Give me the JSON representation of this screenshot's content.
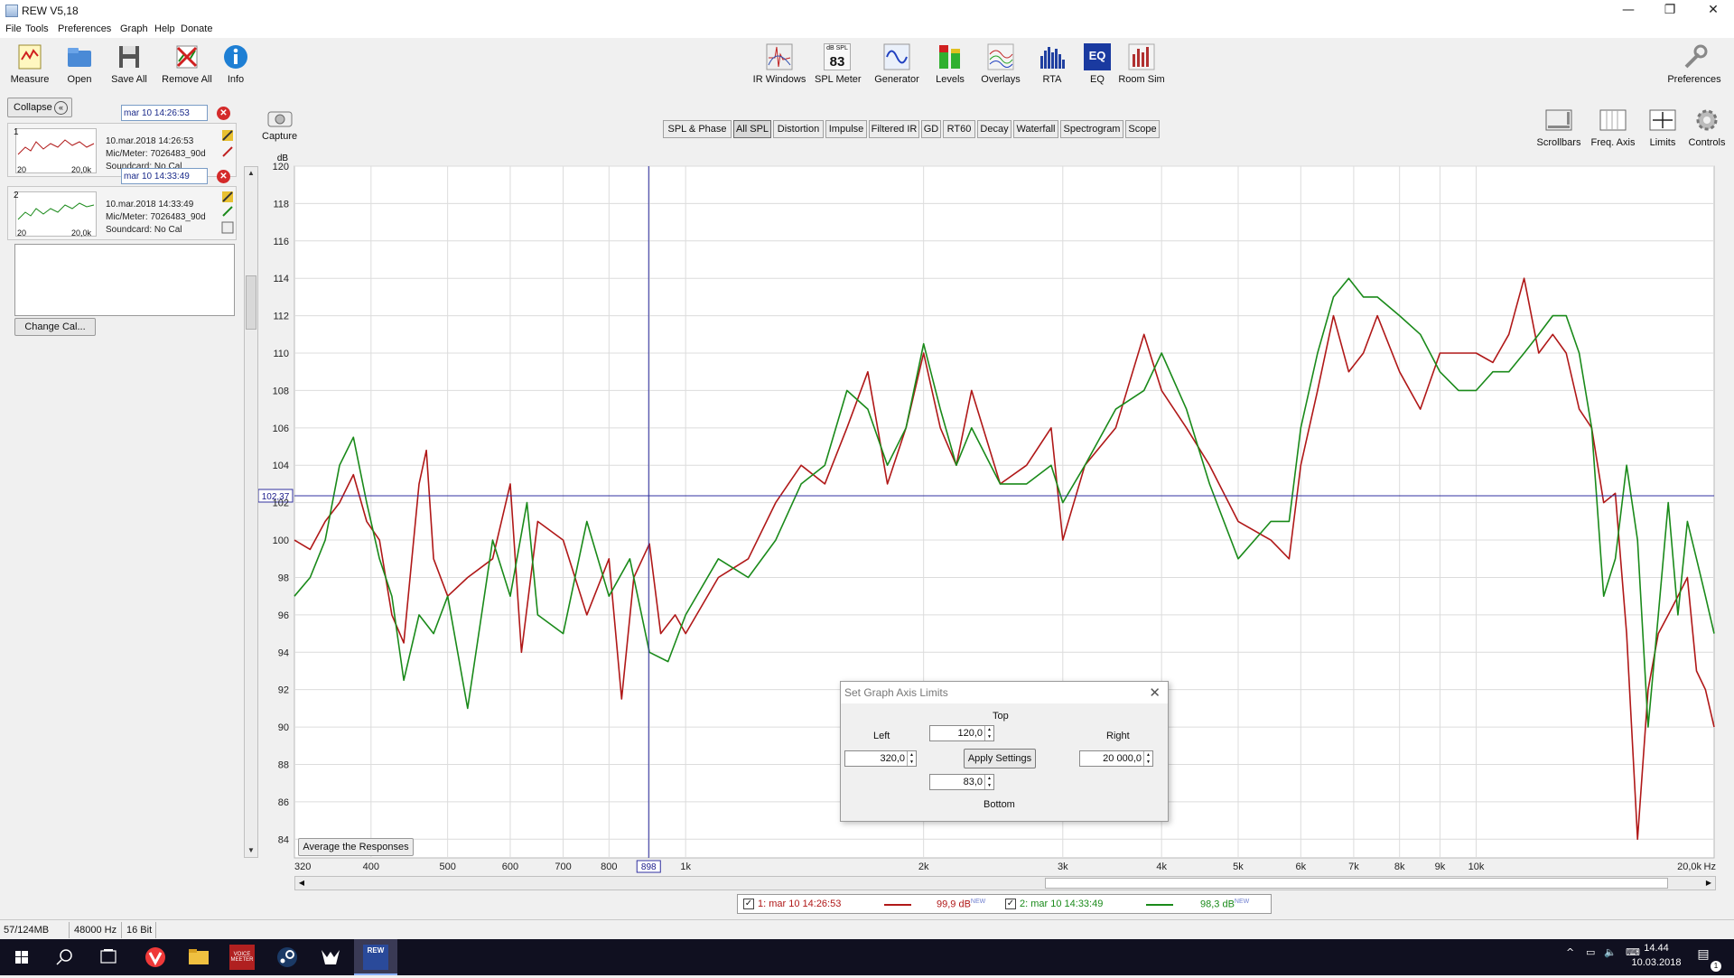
{
  "window": {
    "title": "REW V5,18",
    "minimize": "—",
    "restore": "❐",
    "close": "✕"
  },
  "menu": [
    "File",
    "Tools",
    "Preferences",
    "Graph",
    "Help",
    "Donate"
  ],
  "toolbar_left": [
    {
      "label": "Measure",
      "icon": "measure-icon"
    },
    {
      "label": "Open",
      "icon": "folder-icon"
    },
    {
      "label": "Save All",
      "icon": "save-icon"
    },
    {
      "label": "Remove All",
      "icon": "remove-icon"
    },
    {
      "label": "Info",
      "icon": "info-icon"
    }
  ],
  "toolbar_center": [
    {
      "label": "IR Windows",
      "icon": "ir-windows-icon"
    },
    {
      "label": "SPL Meter",
      "icon": "spl-meter-icon",
      "badge_top": "dB SPL",
      "badge_value": "83"
    },
    {
      "label": "Generator",
      "icon": "generator-icon"
    },
    {
      "label": "Levels",
      "icon": "levels-icon"
    },
    {
      "label": "Overlays",
      "icon": "overlays-icon"
    },
    {
      "label": "RTA",
      "icon": "rta-icon"
    },
    {
      "label": "EQ",
      "icon": "eq-icon",
      "badge_value": "EQ"
    },
    {
      "label": "Room Sim",
      "icon": "room-sim-icon"
    }
  ],
  "preferences": {
    "label": "Preferences",
    "icon": "wrench-icon"
  },
  "panel": {
    "collapse_label": "Collapse",
    "measurements": [
      {
        "num": "1",
        "name": "mar 10 14:26:53",
        "date": "10.mar.2018 14:26:53",
        "mic": "Mic/Meter: 7026483_90d",
        "soundcard": "Soundcard: No Cal",
        "thumb_left": "20",
        "thumb_right": "20,0k",
        "color": "#b01818"
      },
      {
        "num": "2",
        "name": "mar 10 14:33:49",
        "date": "10.mar.2018 14:33:49",
        "mic": "Mic/Meter: 7026483_90d",
        "soundcard": "Soundcard: No Cal",
        "thumb_left": "20",
        "thumb_right": "20,0k",
        "color": "#1a8a1a"
      }
    ],
    "change_cal": "Change Cal..."
  },
  "capture_label": "Capture",
  "tabs": [
    {
      "label": "SPL & Phase",
      "active": false
    },
    {
      "label": "All SPL",
      "active": true
    },
    {
      "label": "Distortion",
      "active": false
    },
    {
      "label": "Impulse",
      "active": false
    },
    {
      "label": "Filtered IR",
      "active": false
    },
    {
      "label": "GD",
      "active": false
    },
    {
      "label": "RT60",
      "active": false
    },
    {
      "label": "Decay",
      "active": false
    },
    {
      "label": "Waterfall",
      "active": false
    },
    {
      "label": "Spectrogram",
      "active": false
    },
    {
      "label": "Scope",
      "active": false
    }
  ],
  "right_tools": [
    {
      "label": "Scrollbars",
      "icon": "scrollbars-icon"
    },
    {
      "label": "Freq. Axis",
      "icon": "freq-axis-icon"
    },
    {
      "label": "Limits",
      "icon": "limits-icon"
    },
    {
      "label": "Controls",
      "icon": "gear-icon"
    }
  ],
  "average_button": "Average the Responses",
  "cursor": {
    "freq_label": "898",
    "level_label": "102,37",
    "freq": 898,
    "level": 102.37
  },
  "legend": [
    {
      "name": "1: mar 10 14:26:53",
      "value": "99,9 dB",
      "tag": "NEW",
      "color": "#b01818",
      "checked": "✓"
    },
    {
      "name": "2: mar 10 14:33:49",
      "value": "98,3 dB",
      "tag": "NEW",
      "color": "#1a8a1a",
      "checked": "✓"
    }
  ],
  "status": {
    "memory": "57/124MB",
    "rate": "48000 Hz",
    "bits": "16 Bit"
  },
  "dialog": {
    "title": "Set Graph Axis Limits",
    "top_label": "Top",
    "left_label": "Left",
    "right_label": "Right",
    "bottom_label": "Bottom",
    "top_value": "120,0",
    "left_value": "320,0",
    "right_value": "20 000,0",
    "bottom_value": "83,0",
    "apply_label": "Apply Settings"
  },
  "taskbar": {
    "time": "14.44",
    "date": "10.03.2018",
    "apps": [
      "start-icon",
      "search-icon",
      "task-view-icon",
      "vivaldi-icon",
      "file-explorer-icon",
      "voicemeeter-icon",
      "steam-icon",
      "app-icon",
      "rew-icon"
    ],
    "voicemeeter_text": "VOICE MEETER",
    "rew_text": "REW",
    "notification_count": "1"
  },
  "chart_data": {
    "type": "line",
    "xscale": "log",
    "xlim": [
      320,
      20000
    ],
    "ylim": [
      83,
      120
    ],
    "ylabel": "dB",
    "xunit": "Hz",
    "yticks": [
      "84",
      "86",
      "88",
      "90",
      "92",
      "94",
      "96",
      "98",
      "100",
      "102",
      "104",
      "106",
      "108",
      "110",
      "112",
      "114",
      "116",
      "118",
      "120"
    ],
    "xticks": [
      {
        "v": 320,
        "l": "320"
      },
      {
        "v": 400,
        "l": "400"
      },
      {
        "v": 500,
        "l": "500"
      },
      {
        "v": 600,
        "l": "600"
      },
      {
        "v": 700,
        "l": "700"
      },
      {
        "v": 800,
        "l": "800"
      },
      {
        "v": 1000,
        "l": "1k"
      },
      {
        "v": 2000,
        "l": "2k"
      },
      {
        "v": 3000,
        "l": "3k"
      },
      {
        "v": 4000,
        "l": "4k"
      },
      {
        "v": 5000,
        "l": "5k"
      },
      {
        "v": 6000,
        "l": "6k"
      },
      {
        "v": 7000,
        "l": "7k"
      },
      {
        "v": 8000,
        "l": "8k"
      },
      {
        "v": 9000,
        "l": "9k"
      },
      {
        "v": 10000,
        "l": "10k"
      },
      {
        "v": 20000,
        "l": "20,0k"
      }
    ],
    "xunit_label": "Hz",
    "series": [
      {
        "name": "1: mar 10 14:26:53",
        "color": "#b01818",
        "points": [
          [
            320,
            100
          ],
          [
            335,
            99.5
          ],
          [
            350,
            101
          ],
          [
            365,
            102
          ],
          [
            380,
            103.5
          ],
          [
            395,
            101
          ],
          [
            410,
            100
          ],
          [
            425,
            96
          ],
          [
            440,
            94.5
          ],
          [
            460,
            103
          ],
          [
            470,
            104.8
          ],
          [
            480,
            99
          ],
          [
            500,
            97
          ],
          [
            530,
            98
          ],
          [
            570,
            99
          ],
          [
            600,
            103
          ],
          [
            620,
            94
          ],
          [
            650,
            101
          ],
          [
            700,
            100
          ],
          [
            750,
            96
          ],
          [
            800,
            99
          ],
          [
            830,
            91.5
          ],
          [
            860,
            98
          ],
          [
            900,
            99.8
          ],
          [
            930,
            95
          ],
          [
            970,
            96
          ],
          [
            1000,
            95
          ],
          [
            1100,
            98
          ],
          [
            1200,
            99
          ],
          [
            1300,
            102
          ],
          [
            1400,
            104
          ],
          [
            1500,
            103
          ],
          [
            1600,
            106
          ],
          [
            1700,
            109
          ],
          [
            1800,
            103
          ],
          [
            1900,
            106
          ],
          [
            2000,
            110
          ],
          [
            2100,
            106
          ],
          [
            2200,
            104
          ],
          [
            2300,
            108
          ],
          [
            2500,
            103
          ],
          [
            2700,
            104
          ],
          [
            2900,
            106
          ],
          [
            3000,
            100
          ],
          [
            3200,
            104
          ],
          [
            3500,
            106
          ],
          [
            3800,
            111
          ],
          [
            4000,
            108
          ],
          [
            4300,
            106
          ],
          [
            4600,
            104
          ],
          [
            5000,
            101
          ],
          [
            5500,
            100
          ],
          [
            5800,
            99
          ],
          [
            6000,
            104
          ],
          [
            6300,
            108
          ],
          [
            6600,
            112
          ],
          [
            6900,
            109
          ],
          [
            7200,
            110
          ],
          [
            7500,
            112
          ],
          [
            8000,
            109
          ],
          [
            8500,
            107
          ],
          [
            9000,
            110
          ],
          [
            9500,
            110
          ],
          [
            10000,
            110
          ],
          [
            10500,
            109.5
          ],
          [
            11000,
            111
          ],
          [
            11500,
            114
          ],
          [
            12000,
            110
          ],
          [
            12500,
            111
          ],
          [
            13000,
            110
          ],
          [
            13500,
            107
          ],
          [
            14000,
            106
          ],
          [
            14500,
            102
          ],
          [
            15000,
            102.5
          ],
          [
            15500,
            95
          ],
          [
            16000,
            84
          ],
          [
            16500,
            92
          ],
          [
            17000,
            95
          ],
          [
            17500,
            96
          ],
          [
            18000,
            97
          ],
          [
            18500,
            98
          ],
          [
            19000,
            93
          ],
          [
            19500,
            92
          ],
          [
            20000,
            90
          ]
        ]
      },
      {
        "name": "2: mar 10 14:33:49",
        "color": "#1a8a1a",
        "points": [
          [
            320,
            97
          ],
          [
            335,
            98
          ],
          [
            350,
            100
          ],
          [
            365,
            104
          ],
          [
            380,
            105.5
          ],
          [
            395,
            102
          ],
          [
            410,
            99
          ],
          [
            425,
            97
          ],
          [
            440,
            92.5
          ],
          [
            460,
            96
          ],
          [
            480,
            95
          ],
          [
            500,
            97
          ],
          [
            530,
            91
          ],
          [
            570,
            100
          ],
          [
            600,
            97
          ],
          [
            630,
            102
          ],
          [
            650,
            96
          ],
          [
            700,
            95
          ],
          [
            750,
            101
          ],
          [
            800,
            97
          ],
          [
            850,
            99
          ],
          [
            900,
            94
          ],
          [
            950,
            93.5
          ],
          [
            1000,
            96
          ],
          [
            1100,
            99
          ],
          [
            1200,
            98
          ],
          [
            1300,
            100
          ],
          [
            1400,
            103
          ],
          [
            1500,
            104
          ],
          [
            1600,
            108
          ],
          [
            1700,
            107
          ],
          [
            1800,
            104
          ],
          [
            1900,
            106
          ],
          [
            2000,
            110.5
          ],
          [
            2100,
            107
          ],
          [
            2200,
            104
          ],
          [
            2300,
            106
          ],
          [
            2500,
            103
          ],
          [
            2700,
            103
          ],
          [
            2900,
            104
          ],
          [
            3000,
            102
          ],
          [
            3200,
            104
          ],
          [
            3500,
            107
          ],
          [
            3800,
            108
          ],
          [
            4000,
            110
          ],
          [
            4300,
            107
          ],
          [
            4600,
            103
          ],
          [
            5000,
            99
          ],
          [
            5500,
            101
          ],
          [
            5800,
            101
          ],
          [
            6000,
            106
          ],
          [
            6300,
            110
          ],
          [
            6600,
            113
          ],
          [
            6900,
            114
          ],
          [
            7200,
            113
          ],
          [
            7500,
            113
          ],
          [
            8000,
            112
          ],
          [
            8500,
            111
          ],
          [
            9000,
            109
          ],
          [
            9500,
            108
          ],
          [
            10000,
            108
          ],
          [
            10500,
            109
          ],
          [
            11000,
            109
          ],
          [
            11500,
            110
          ],
          [
            12000,
            111
          ],
          [
            12500,
            112
          ],
          [
            13000,
            112
          ],
          [
            13500,
            110
          ],
          [
            14000,
            106
          ],
          [
            14500,
            97
          ],
          [
            15000,
            99
          ],
          [
            15500,
            104
          ],
          [
            16000,
            100
          ],
          [
            16500,
            90
          ],
          [
            17000,
            96
          ],
          [
            17500,
            102
          ],
          [
            18000,
            96
          ],
          [
            18500,
            101
          ],
          [
            19000,
            99
          ],
          [
            19500,
            97
          ],
          [
            20000,
            95
          ]
        ]
      }
    ]
  }
}
